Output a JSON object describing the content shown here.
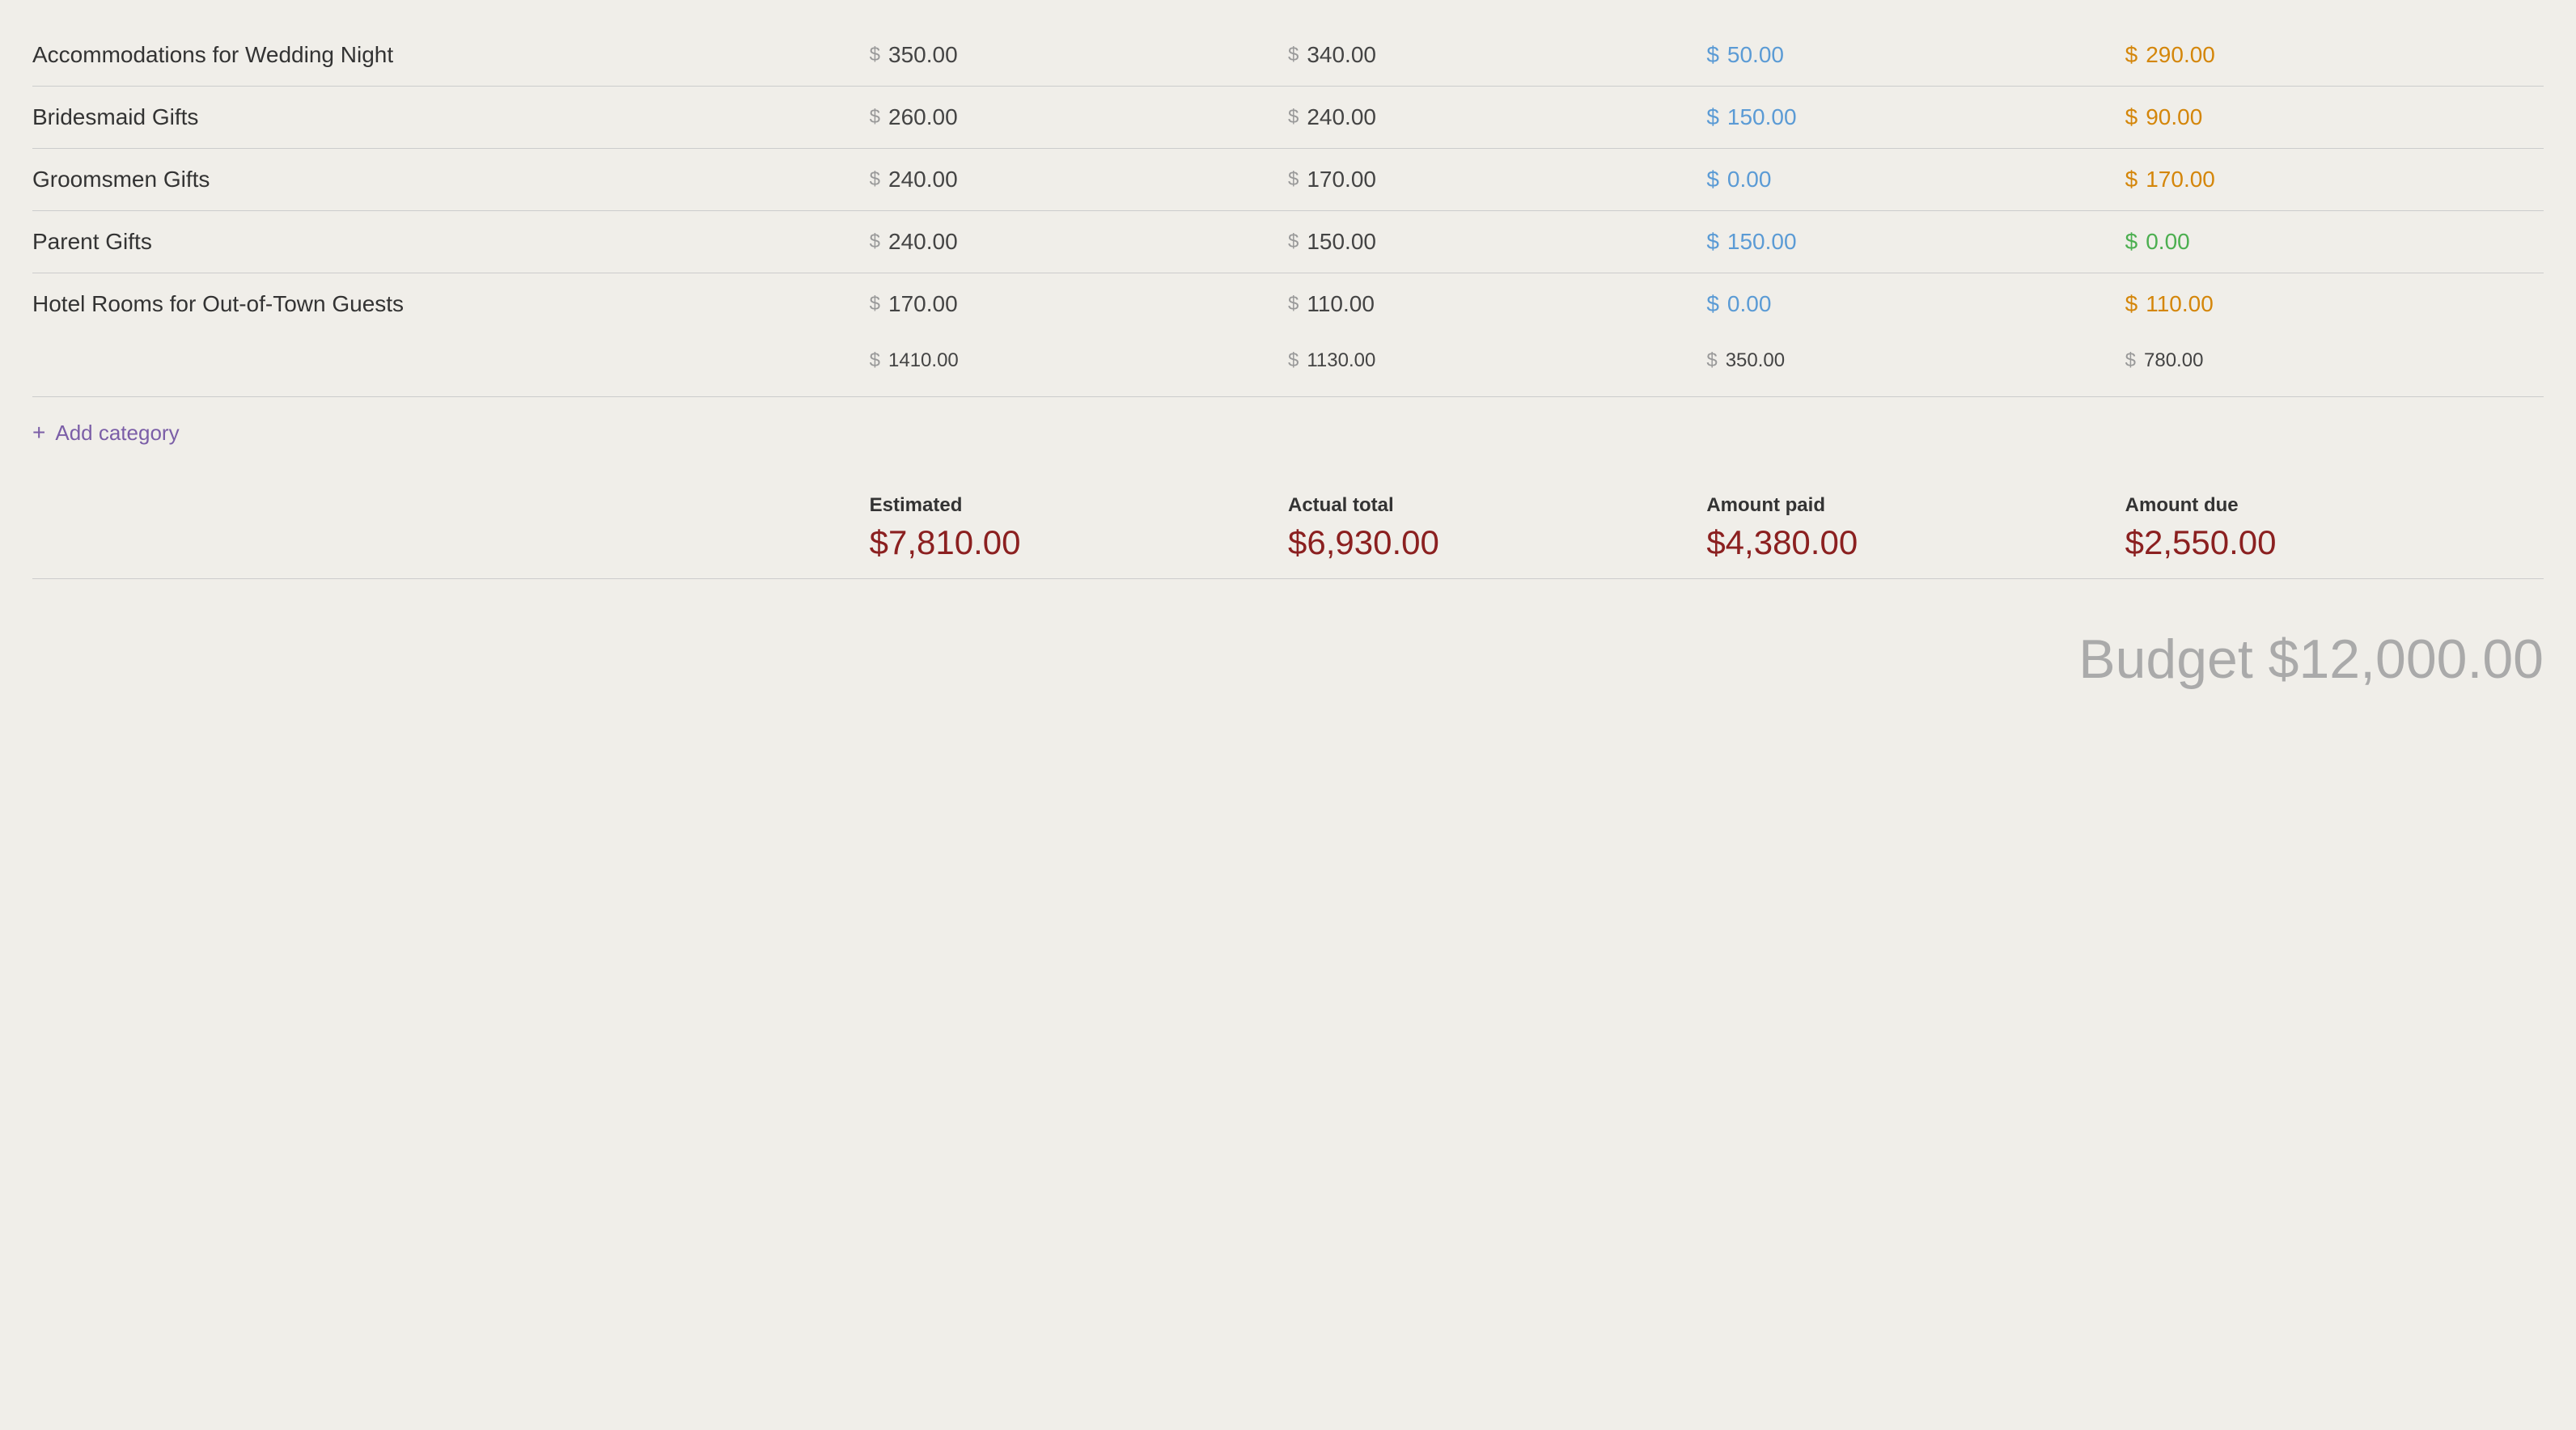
{
  "rows": [
    {
      "id": "accommodations",
      "name": "Accommodations for Wedding Night",
      "estimated": "350.00",
      "actual": "340.00",
      "paid": "50.00",
      "due": "290.00",
      "due_color": "orange"
    },
    {
      "id": "bridesmaid-gifts",
      "name": "Bridesmaid Gifts",
      "estimated": "260.00",
      "actual": "240.00",
      "paid": "150.00",
      "due": "90.00",
      "due_color": "orange"
    },
    {
      "id": "groomsmen-gifts",
      "name": "Groomsmen Gifts",
      "estimated": "240.00",
      "actual": "170.00",
      "paid": "0.00",
      "due": "170.00",
      "due_color": "orange"
    },
    {
      "id": "parent-gifts",
      "name": "Parent Gifts",
      "estimated": "240.00",
      "actual": "150.00",
      "paid": "150.00",
      "due": "0.00",
      "due_color": "green"
    },
    {
      "id": "hotel-rooms",
      "name": "Hotel Rooms for Out-of-Town Guests",
      "estimated": "170.00",
      "actual": "110.00",
      "paid": "0.00",
      "due": "110.00",
      "due_color": "orange"
    }
  ],
  "column_totals": {
    "estimated": "1410.00",
    "actual": "1130.00",
    "paid": "350.00",
    "due": "780.00"
  },
  "add_category_label": "Add category",
  "summary": {
    "estimated_label": "Estimated",
    "estimated_value": "$7,810.00",
    "actual_label": "Actual total",
    "actual_value": "$6,930.00",
    "paid_label": "Amount paid",
    "paid_value": "$4,380.00",
    "due_label": "Amount due",
    "due_value": "$2,550.00"
  },
  "budget_label": "Budget $12,000.00",
  "colors": {
    "paid_blue": "#5b9bd5",
    "due_orange": "#d4880a",
    "due_green": "#4caf50",
    "add_category_purple": "#7b5ea7",
    "summary_red": "#8b2020"
  }
}
